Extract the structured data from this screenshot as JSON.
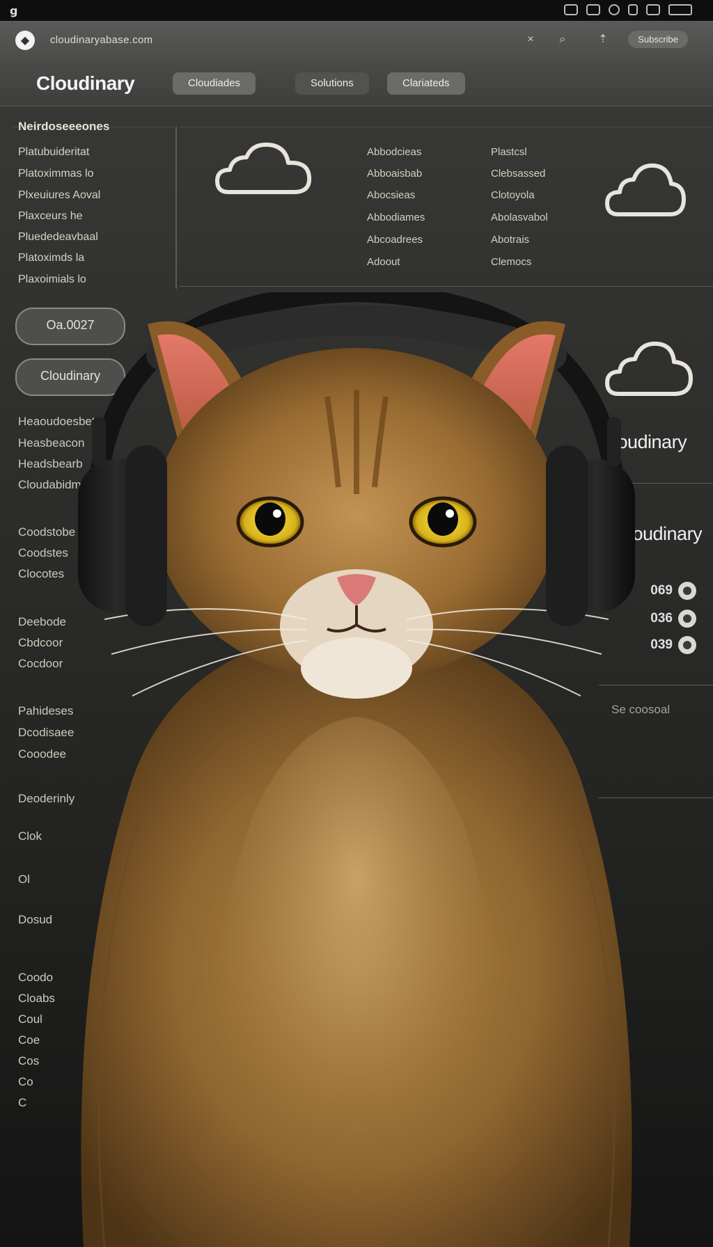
{
  "statusbar": {
    "logo": "g"
  },
  "browser": {
    "url": "cloudinaryabase.com",
    "action_label": "Subscribe"
  },
  "nav": {
    "brand": "Cloudinary",
    "tabs": [
      "Cloudiades",
      "Solutions",
      "Clariateds"
    ]
  },
  "sidebar": {
    "heading": "Neirdoseeeones",
    "items": [
      "Platubuideritat",
      "Platoximmas lo",
      "Plxeuiures Aoval",
      "Plaxceurs he",
      "Pluededeavbaal",
      "Platoximds la",
      "Plaxoimials lo"
    ],
    "pill_1": "Oa.0027",
    "pill_2": "Cloudinary",
    "groups": [
      [
        "Heaoudoesbet",
        "Heasbeacon",
        "Headsbearb",
        "Cloudabidmig"
      ],
      [
        "Coodstobe",
        "Coodstes",
        "Clocotes"
      ],
      [
        "Deebode",
        "Cbdcoor",
        "Cocdoor"
      ],
      [
        "Pahideses",
        "Dcodisaee",
        "Cooodee"
      ],
      [
        "Deoderinly"
      ],
      [
        "Clok"
      ],
      [
        "Ol"
      ],
      [
        "Dosud"
      ],
      [
        "Coodo",
        "Cloabs",
        "Coul",
        "Coe",
        "Cos",
        "Co",
        "C"
      ]
    ]
  },
  "main": {
    "col1": [
      "Abbodcieas",
      "Abboaisbab",
      "Abocsieas",
      "Abbodiames",
      "Abcoadrees",
      "Adoout"
    ],
    "col2": [
      "Plastcsl",
      "Clebsassed",
      "Clotoyola",
      "Abolasvabol",
      "Abotrais",
      "Clemocs"
    ]
  },
  "right": {
    "brand_1": "Cloudinary",
    "brand_2": "Cloudinary",
    "toggles": [
      "069",
      "036",
      "039"
    ],
    "faint": "Se coosoal"
  }
}
